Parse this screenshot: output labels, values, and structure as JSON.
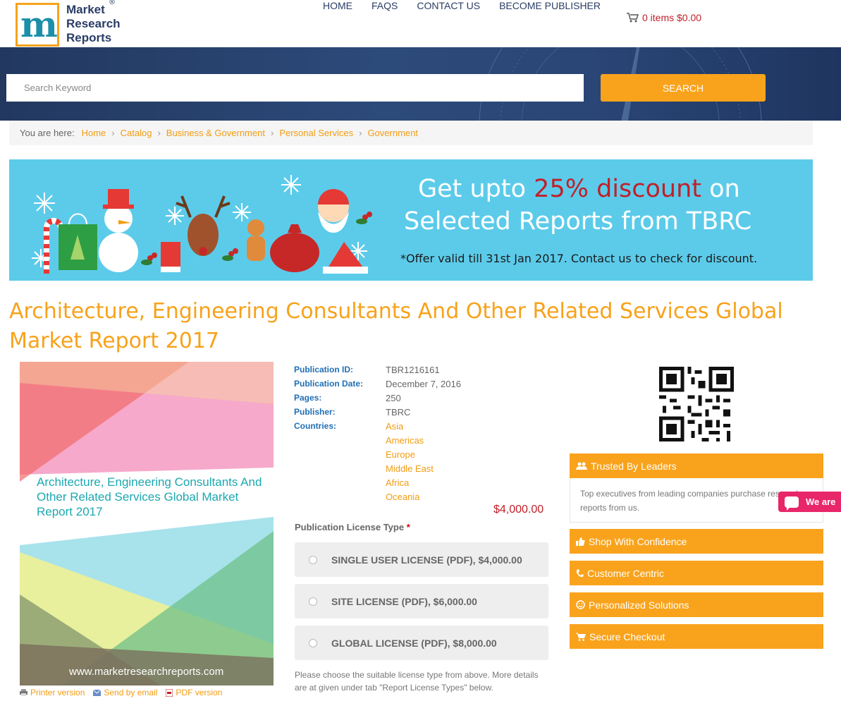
{
  "header": {
    "logo_letter": "m",
    "logo_lines": [
      "Market",
      "Research",
      "Reports"
    ],
    "logo_reg": "®",
    "nav": [
      "HOME",
      "FAQS",
      "CONTACT US",
      "BECOME PUBLISHER"
    ],
    "cart": "0 items $0.00"
  },
  "search": {
    "placeholder": "Search Keyword",
    "button": "SEARCH"
  },
  "breadcrumb": {
    "lead": "You are here:",
    "items": [
      "Home",
      "Catalog",
      "Business & Government",
      "Personal Services",
      "Government"
    ]
  },
  "promo": {
    "line1_pre": "Get upto ",
    "line1_highlight": "25% discount",
    "line1_post": " on",
    "line2": "Selected Reports from TBRC",
    "note": "*Offer valid till 31st Jan 2017. Contact us to check for discount."
  },
  "report": {
    "title": "Architecture, Engineering Consultants And Other Related Services Global Market Report 2017",
    "cover_title": "Architecture, Engineering Consultants And Other Related Services Global Market Report 2017",
    "cover_url": "www.marketresearchreports.com",
    "links": [
      "Printer version",
      "Send by email",
      "PDF version"
    ]
  },
  "details": {
    "labels": {
      "pub_id": "Publication ID:",
      "pub_date": "Publication Date:",
      "pages": "Pages:",
      "publisher": "Publisher:",
      "countries": "Countries:"
    },
    "pub_id": "TBR1216161",
    "pub_date": "December 7, 2016",
    "pages": "250",
    "publisher": "TBRC",
    "countries": [
      "Asia",
      "Americas",
      "Europe",
      "Middle East",
      "Africa",
      "Oceania"
    ],
    "price": "$4,000.00"
  },
  "license": {
    "heading": "Publication License Type",
    "required": "*",
    "options": [
      "SINGLE USER LICENSE (PDF), $4,000.00",
      "SITE LICENSE (PDF), $6,000.00",
      "GLOBAL LICENSE (PDF), $8,000.00"
    ],
    "note": "Please choose the suitable license type from above. More details are at given under tab \"Report License Types\" below."
  },
  "sidebar": {
    "panels": [
      {
        "label": "Trusted By Leaders",
        "icon": "users-icon"
      },
      {
        "label": "Shop With Confidence",
        "icon": "thumbs-up-icon"
      },
      {
        "label": "Customer Centric",
        "icon": "phone-icon"
      },
      {
        "label": "Personalized Solutions",
        "icon": "smile-icon"
      },
      {
        "label": "Secure Checkout",
        "icon": "cart-icon"
      }
    ],
    "trusted_body": "Top executives from leading companies purchase research reports from us."
  },
  "chat": {
    "label": "We are"
  },
  "colors": {
    "accent": "#f9a31c",
    "nav_blue": "#2a3d66",
    "promo_bg": "#5ccbea",
    "price_red": "#c0202a"
  }
}
